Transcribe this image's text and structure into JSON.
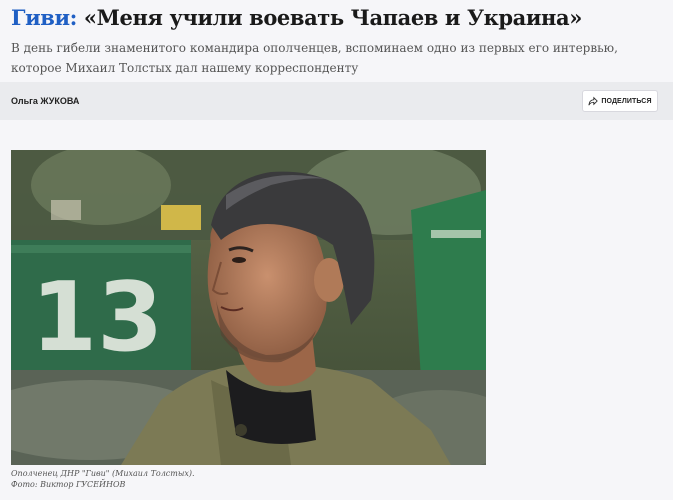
{
  "article": {
    "rubric": "Гиви:",
    "title": "«Меня учили воевать Чапаев и Украина»",
    "subtitle": "В день гибели знаменитого командира ополченцев, вспоминаем одно из первых его интервью, которое Михаил Толстых дал нашему корреспонденту"
  },
  "author_bar": {
    "author": "Ольга ЖУКОВА",
    "share_label": "ПОДЕЛИТЬСЯ",
    "share_icon": "share-arrow-icon"
  },
  "photo": {
    "caption_line1": "Ополченец ДНР \"Гиви\" (Михаил Толстых).",
    "caption_line2": "Фото: Виктор ГУСЕЙНОВ"
  },
  "colors": {
    "rubric": "#1f5fc4",
    "header_bg": "#f6f6f9",
    "author_bar_bg": "#eaebee"
  }
}
